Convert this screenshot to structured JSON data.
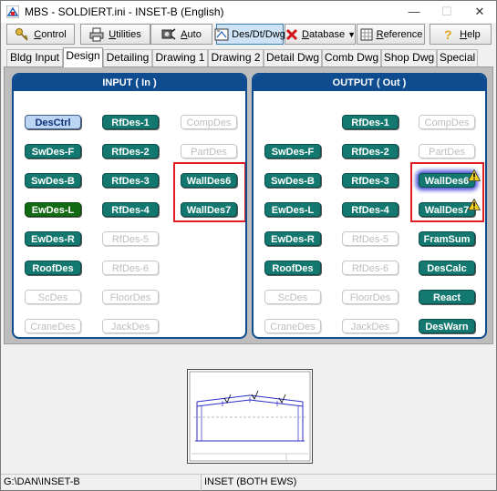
{
  "window": {
    "title": "MBS - SOLDIERT.ini - INSET-B (English)",
    "minimize": "—",
    "maximize": "☐",
    "close": "✕"
  },
  "toolbar": [
    {
      "label": "Control",
      "underline": "C",
      "rest": "ontrol",
      "icon": "key-icon"
    },
    {
      "label": "Utilities",
      "underline": "U",
      "rest": "tilities",
      "icon": "printer-icon"
    },
    {
      "label": "Auto",
      "underline": "A",
      "rest": "uto",
      "icon": "machine-icon"
    },
    {
      "label": "Des/Dt/Dwg",
      "icon": "drawing-icon",
      "active": true
    },
    {
      "label": "Database",
      "underline": "D",
      "rest": "atabase",
      "icon": "x-icon"
    },
    {
      "label": "Reference",
      "underline": "R",
      "rest": "eference",
      "icon": "book-icon"
    },
    {
      "label": "Help",
      "underline": "H",
      "rest": "elp",
      "icon": "question-icon"
    }
  ],
  "tabs": [
    "Bldg Input",
    "Design",
    "Detailing",
    "Drawing 1",
    "Drawing 2",
    "Detail Dwg",
    "Comb Dwg",
    "Shop Dwg",
    "Special"
  ],
  "selected_tab": "Design",
  "input_panel": {
    "header": "INPUT ( In )",
    "col1": [
      "DesCtrl",
      "SwDes-F",
      "SwDes-B",
      "EwDes-L",
      "EwDes-R",
      "RoofDes",
      "ScDes",
      "CraneDes"
    ],
    "col2": [
      "RfDes-1",
      "RfDes-2",
      "RfDes-3",
      "RfDes-4",
      "RfDes-5",
      "RfDes-6",
      "FloorDes",
      "JackDes"
    ],
    "col3": [
      "CompDes",
      "PartDes",
      "WallDes6",
      "WallDes7"
    ]
  },
  "output_panel": {
    "header": "OUTPUT ( Out )",
    "col1": [
      "SwDes-F",
      "SwDes-B",
      "EwDes-L",
      "EwDes-R",
      "RoofDes",
      "ScDes",
      "CraneDes"
    ],
    "col2": [
      "RfDes-1",
      "RfDes-2",
      "RfDes-3",
      "RfDes-4",
      "RfDes-5",
      "RfDes-6",
      "FloorDes",
      "JackDes"
    ],
    "col3": [
      "CompDes",
      "PartDes",
      "WallDes6",
      "WallDes7",
      "FramSum",
      "DesCalc",
      "React",
      "DesWarn"
    ]
  },
  "status_bar": {
    "path": "G:\\DAN\\INSET-B",
    "description": "INSET (BOTH EWS)"
  },
  "colors": {
    "panel_header": "#0e4b8f",
    "button_teal": "#13786f",
    "highlight_red": "#e11d25",
    "warning_yellow": "#f6d21a"
  }
}
